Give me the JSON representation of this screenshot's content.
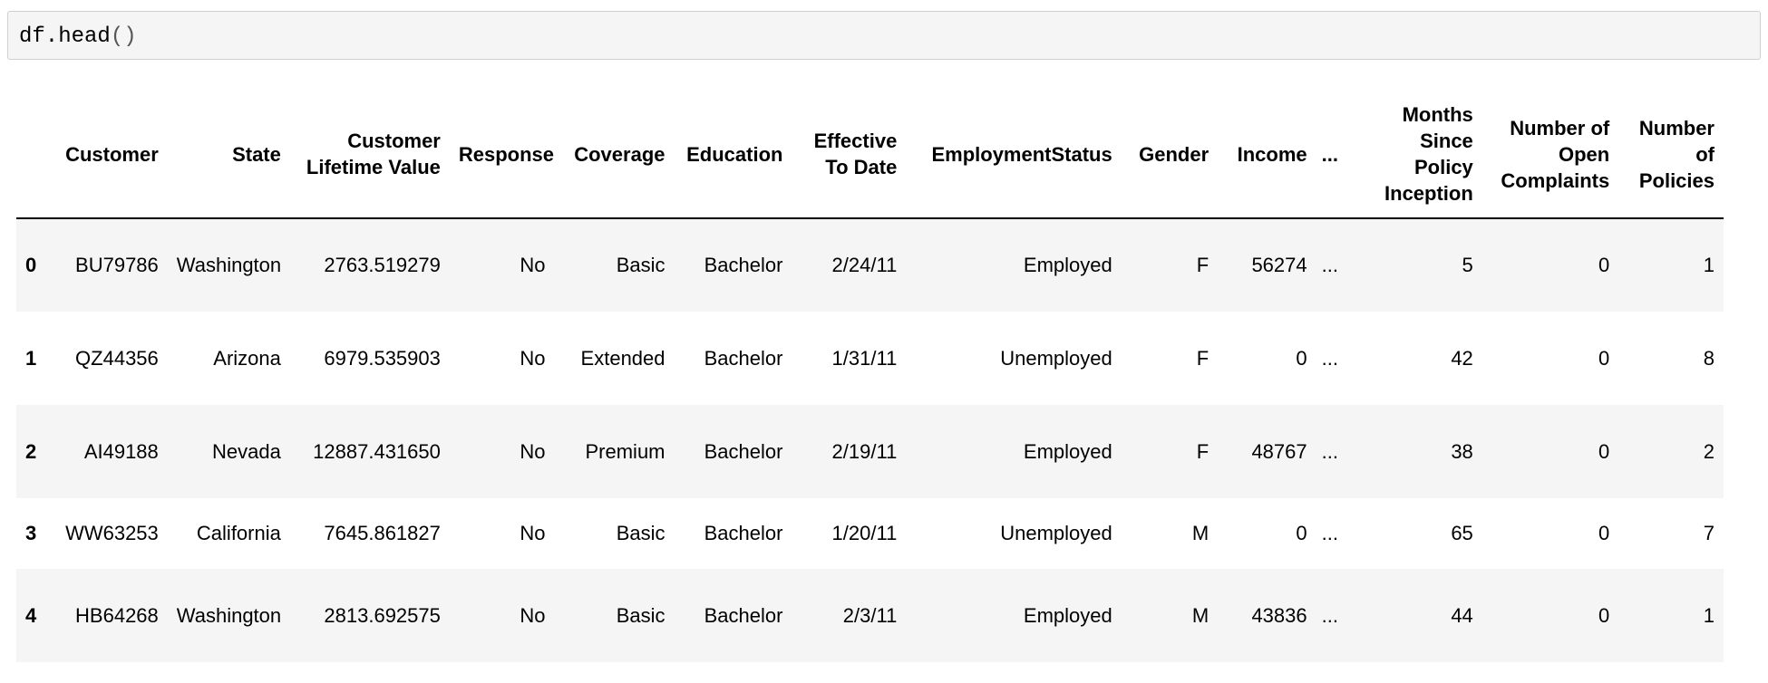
{
  "input_cell": {
    "code_name": "df.head",
    "code_parens": "()"
  },
  "table": {
    "index_header": "",
    "columns": [
      "Customer",
      "State",
      "Customer Lifetime Value",
      "Response",
      "Coverage",
      "Education",
      "Effective To Date",
      "EmploymentStatus",
      "Gender",
      "Income",
      "...",
      "Months Since Policy Inception",
      "Number of Open Complaints",
      "Number of Policies"
    ],
    "rows": [
      {
        "index": "0",
        "cells": [
          "BU79786",
          "Washington",
          "2763.519279",
          "No",
          "Basic",
          "Bachelor",
          "2/24/11",
          "Employed",
          "F",
          "56274",
          "...",
          "5",
          "0",
          "1"
        ]
      },
      {
        "index": "1",
        "cells": [
          "QZ44356",
          "Arizona",
          "6979.535903",
          "No",
          "Extended",
          "Bachelor",
          "1/31/11",
          "Unemployed",
          "F",
          "0",
          "...",
          "42",
          "0",
          "8"
        ]
      },
      {
        "index": "2",
        "cells": [
          "AI49188",
          "Nevada",
          "12887.431650",
          "No",
          "Premium",
          "Bachelor",
          "2/19/11",
          "Employed",
          "F",
          "48767",
          "...",
          "38",
          "0",
          "2"
        ]
      },
      {
        "index": "3",
        "cells": [
          "WW63253",
          "California",
          "7645.861827",
          "No",
          "Basic",
          "Bachelor",
          "1/20/11",
          "Unemployed",
          "M",
          "0",
          "...",
          "65",
          "0",
          "7"
        ]
      },
      {
        "index": "4",
        "cells": [
          "HB64268",
          "Washington",
          "2813.692575",
          "No",
          "Basic",
          "Bachelor",
          "2/3/11",
          "Employed",
          "M",
          "43836",
          "...",
          "44",
          "0",
          "1"
        ]
      }
    ]
  }
}
